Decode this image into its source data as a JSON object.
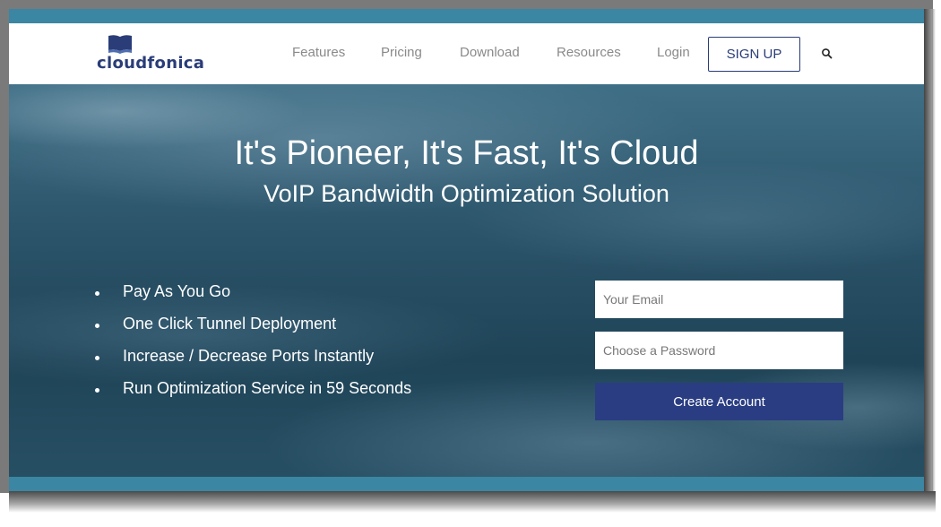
{
  "brand": {
    "name": "cloudfonica",
    "color": "#2a3d78"
  },
  "nav": {
    "items": [
      {
        "label": "Features"
      },
      {
        "label": "Pricing"
      },
      {
        "label": "Download"
      },
      {
        "label": "Resources"
      },
      {
        "label": "Login"
      }
    ],
    "signup_label": "SIGN UP",
    "search_icon": "search-icon"
  },
  "hero": {
    "title": "It's Pioneer, It's Fast, It's Cloud",
    "subtitle": "VoIP Bandwidth Optimization Solution",
    "features": [
      "Pay As You Go",
      "One Click Tunnel Deployment",
      "Increase / Decrease Ports Instantly",
      "Run Optimization Service in 59 Seconds"
    ]
  },
  "form": {
    "email_placeholder": "Your Email",
    "password_placeholder": "Choose a Password",
    "submit_label": "Create Account",
    "submit_color": "#2a3d82"
  },
  "colors": {
    "frame_teal": "#3b86a2",
    "nav_text": "#8a8a8a"
  }
}
